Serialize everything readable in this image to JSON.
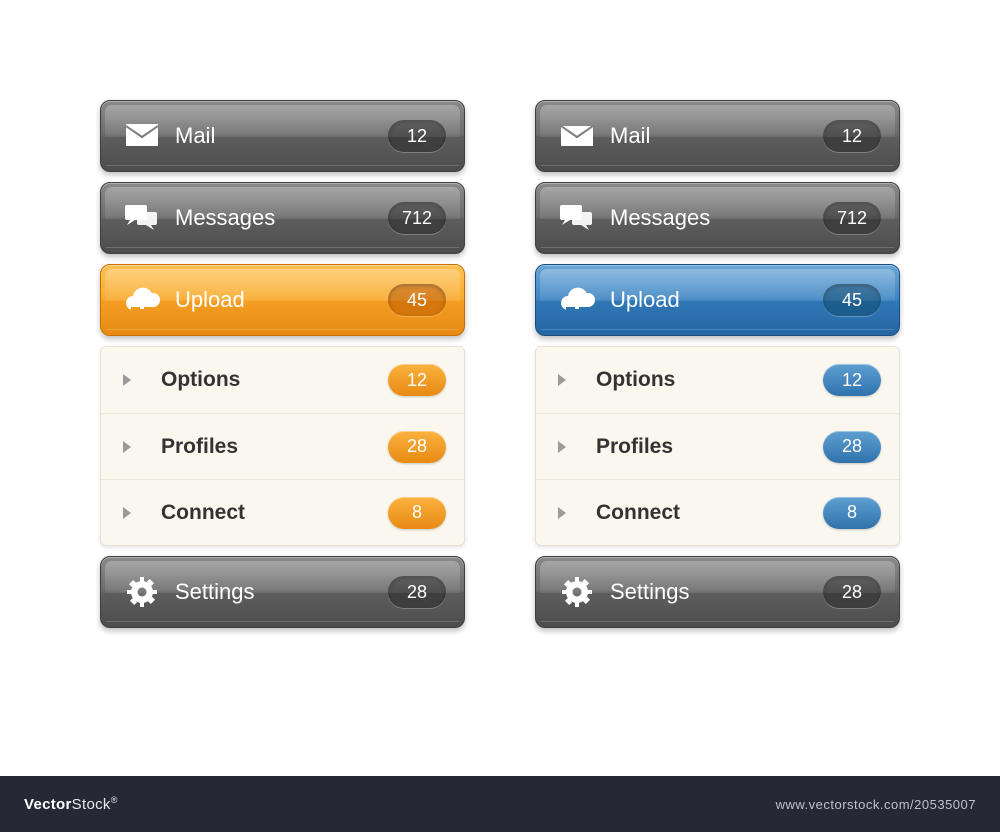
{
  "accentLeft": "orange",
  "accentRight": "blue",
  "menus": {
    "left": {
      "items": [
        {
          "icon": "mail",
          "label": "Mail",
          "badge": "12",
          "style": "gray"
        },
        {
          "icon": "messages",
          "label": "Messages",
          "badge": "712",
          "style": "gray"
        },
        {
          "icon": "upload",
          "label": "Upload",
          "badge": "45",
          "style": "orange",
          "expanded": true
        }
      ],
      "sub": [
        {
          "label": "Options",
          "badge": "12"
        },
        {
          "label": "Profiles",
          "badge": "28"
        },
        {
          "label": "Connect",
          "badge": "8"
        }
      ],
      "tail": [
        {
          "icon": "settings",
          "label": "Settings",
          "badge": "28",
          "style": "gray"
        }
      ]
    },
    "right": {
      "items": [
        {
          "icon": "mail",
          "label": "Mail",
          "badge": "12",
          "style": "gray"
        },
        {
          "icon": "messages",
          "label": "Messages",
          "badge": "712",
          "style": "gray"
        },
        {
          "icon": "upload",
          "label": "Upload",
          "badge": "45",
          "style": "blue",
          "expanded": true
        }
      ],
      "sub": [
        {
          "label": "Options",
          "badge": "12"
        },
        {
          "label": "Profiles",
          "badge": "28"
        },
        {
          "label": "Connect",
          "badge": "8"
        }
      ],
      "tail": [
        {
          "icon": "settings",
          "label": "Settings",
          "badge": "28",
          "style": "gray"
        }
      ]
    }
  },
  "footer": {
    "brandA": "Vector",
    "brandB": "Stock",
    "imageId": "www.vectorstock.com/20535007"
  }
}
